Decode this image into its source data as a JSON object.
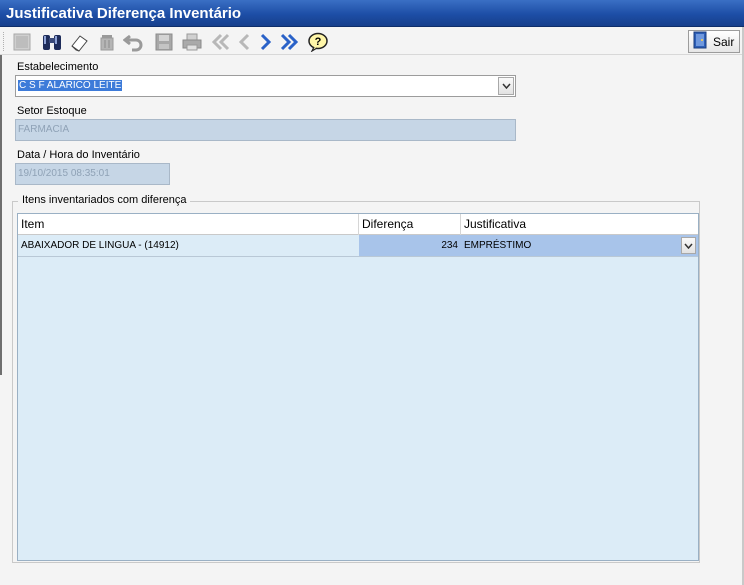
{
  "window": {
    "title": "Justificativa Diferença Inventário"
  },
  "toolbar": {
    "buttons": [
      {
        "name": "new-icon"
      },
      {
        "name": "binoculars-icon"
      },
      {
        "name": "eraser-icon"
      },
      {
        "name": "trash-icon"
      },
      {
        "name": "undo-icon"
      },
      {
        "name": "save-disk-icon"
      },
      {
        "name": "printer-icon"
      },
      {
        "name": "first-record-icon"
      },
      {
        "name": "previous-record-icon"
      },
      {
        "name": "next-record-icon"
      },
      {
        "name": "last-record-icon"
      },
      {
        "name": "help-icon"
      }
    ],
    "exit_label": "Sair"
  },
  "form": {
    "estabelecimento_label": "Estabelecimento",
    "estabelecimento_value": "C S F ALARICO LEITE",
    "setor_label": "Setor Estoque",
    "setor_value": "FARMACIA",
    "data_label": "Data / Hora do Inventário",
    "data_value": "19/10/2015 08:35:01"
  },
  "group": {
    "legend": "Itens inventariados com diferença",
    "columns": [
      "Item",
      "Diferença",
      "Justificativa"
    ],
    "rows": [
      {
        "item": "ABAIXADOR DE LINGUA - (14912)",
        "diferenca": "234",
        "justificativa": "EMPRÉSTIMO"
      }
    ]
  },
  "colors": {
    "titlebar": "#1d4ea6",
    "selection": "#3d7bd9",
    "disabled_field": "#c6d6e6",
    "grid_background": "#dcecf7",
    "selected_cell": "#a8c4ea"
  }
}
